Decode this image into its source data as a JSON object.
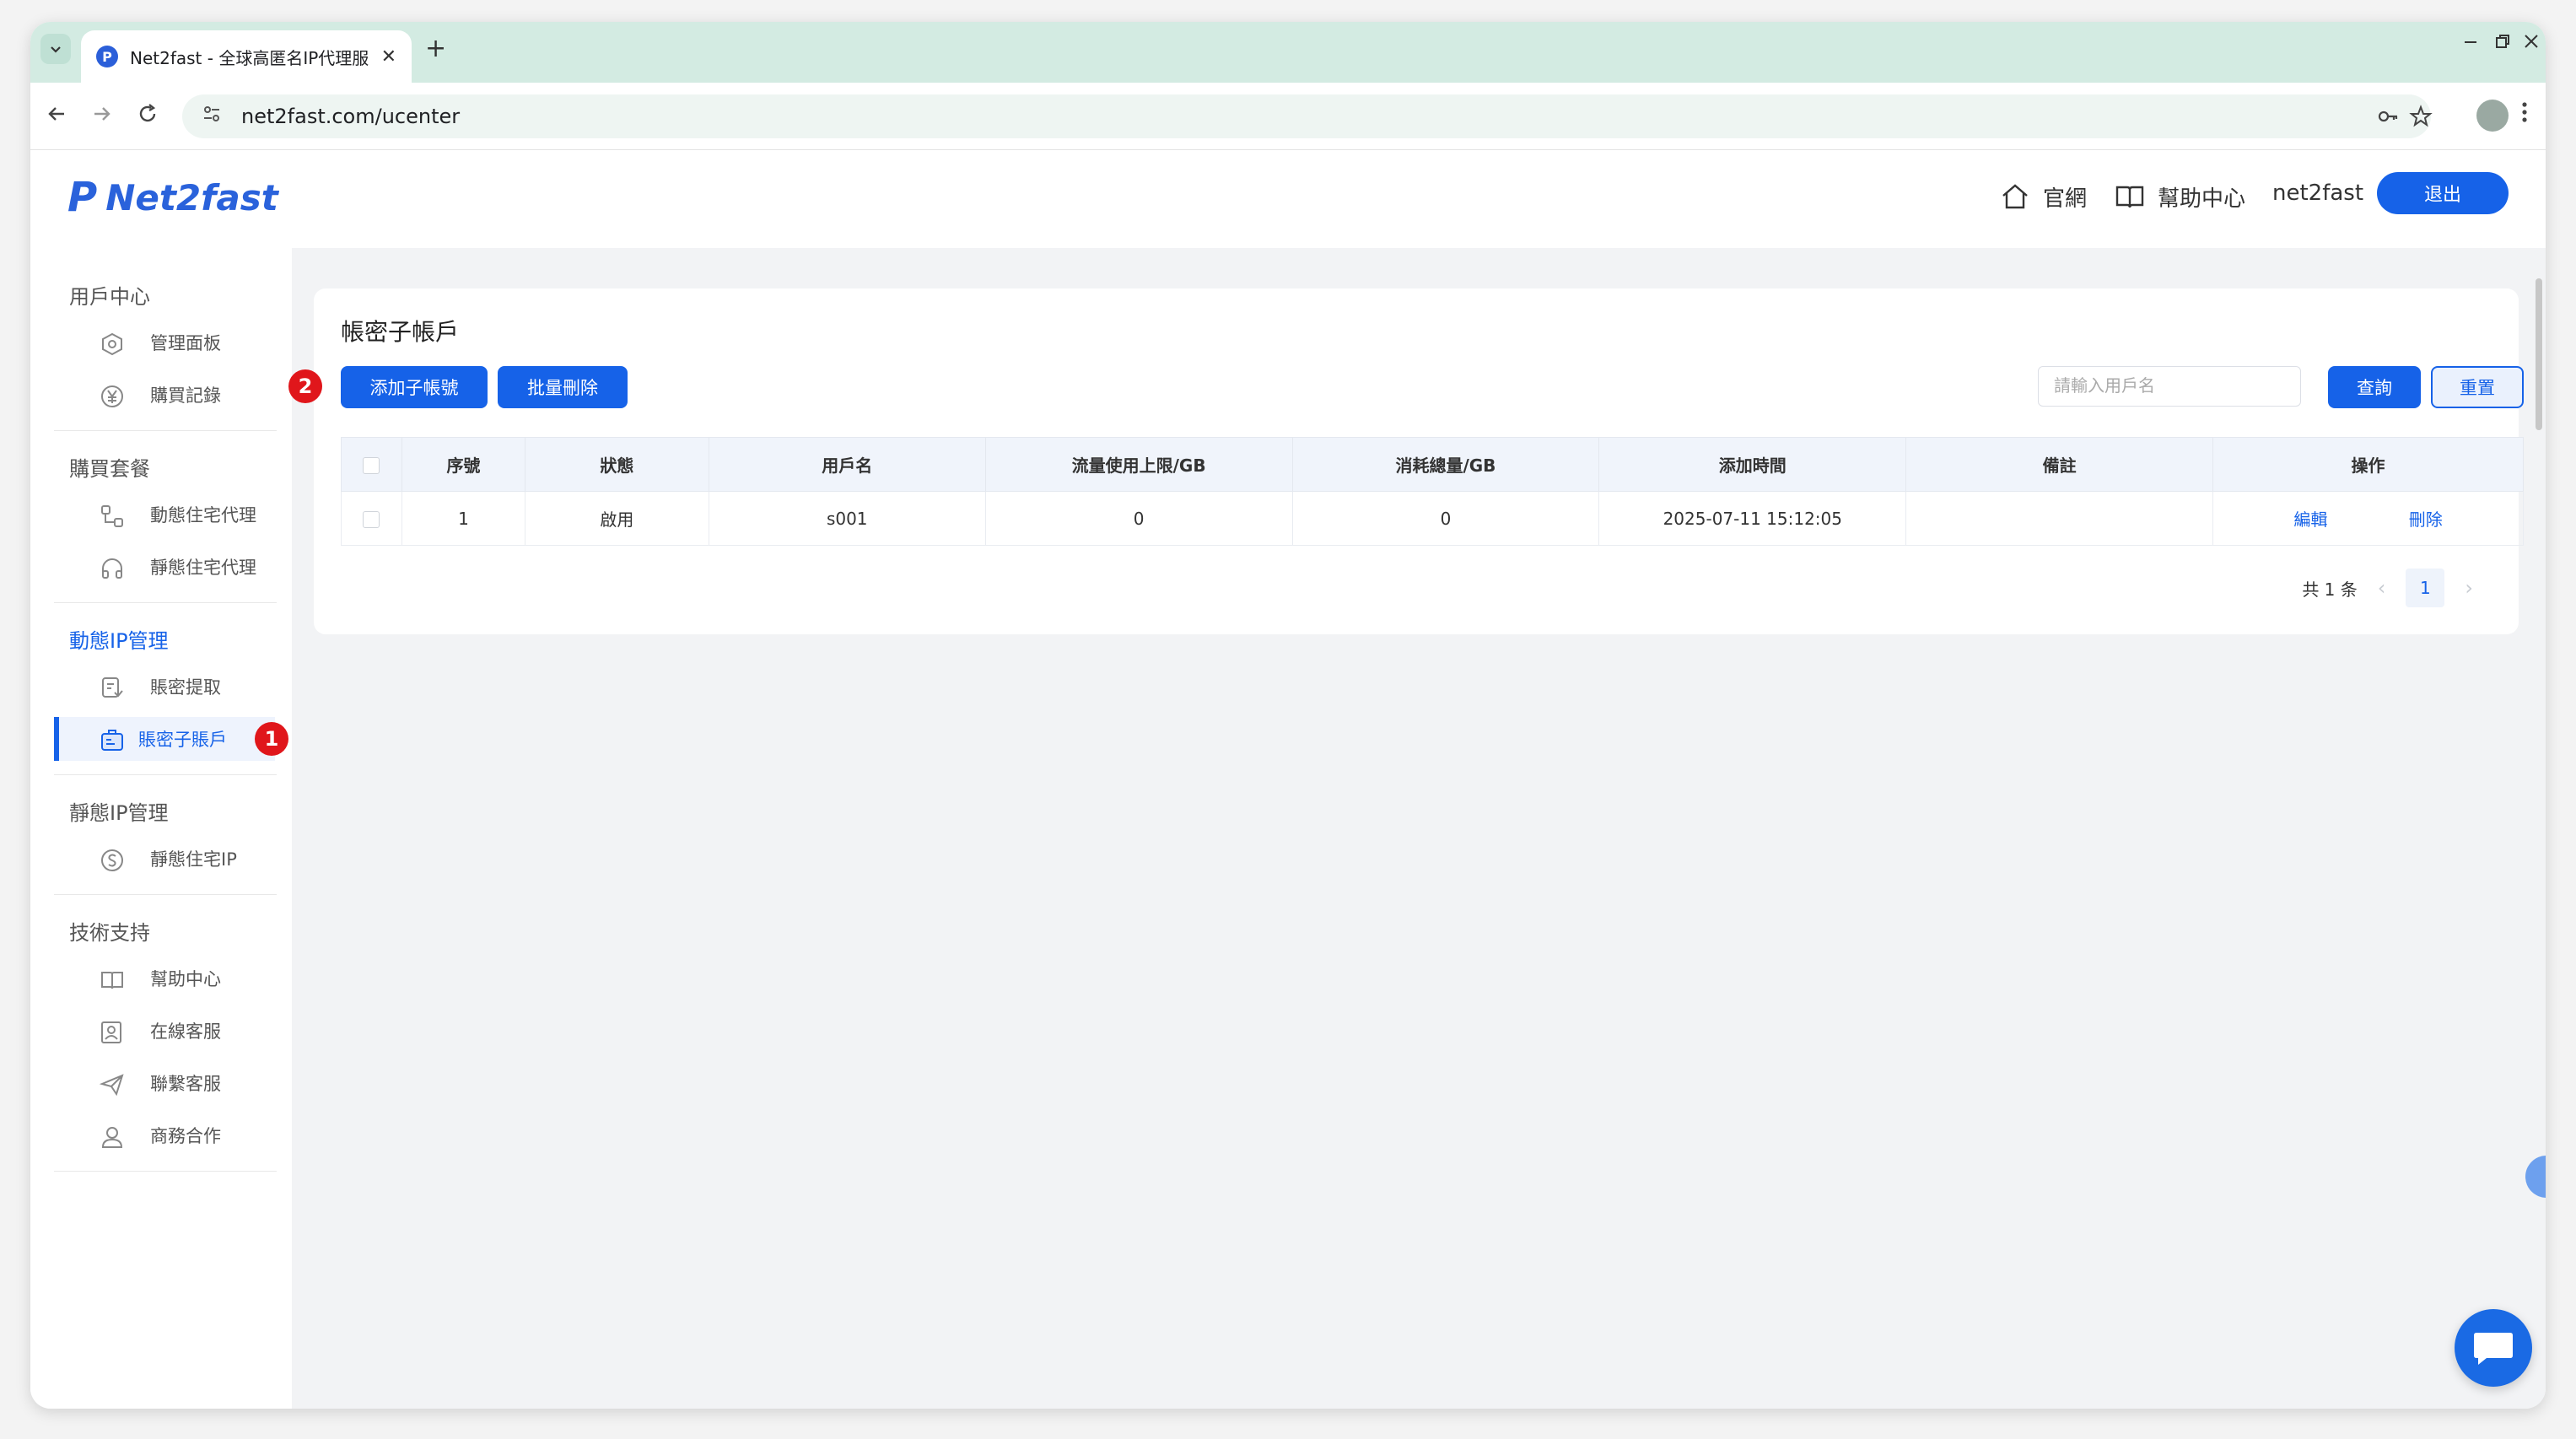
{
  "browser": {
    "tab_title": "Net2fast - 全球高匿名IP代理服",
    "tab_favicon": "P",
    "url": "net2fast.com/ucenter",
    "new_tab": "+",
    "close_tab": "✕"
  },
  "header": {
    "logo_mark": "P",
    "logo_text": "Net2fast",
    "home_label": "官網",
    "help_label": "幫助中心",
    "username": "net2fast",
    "logout_label": "退出"
  },
  "sidebar": {
    "groups": [
      {
        "title": "用戶中心",
        "items": [
          {
            "label": "管理面板",
            "icon": "dashboard-icon"
          },
          {
            "label": "購買記錄",
            "icon": "yuan-icon"
          }
        ]
      },
      {
        "title": "購買套餐",
        "items": [
          {
            "label": "動態住宅代理",
            "icon": "nodes-icon"
          },
          {
            "label": "靜態住宅代理",
            "icon": "headset-icon"
          }
        ]
      },
      {
        "title": "動態IP管理",
        "items": [
          {
            "label": "賬密提取",
            "icon": "extract-icon"
          },
          {
            "label": "賬密子賬戶",
            "icon": "badge-icon"
          }
        ]
      },
      {
        "title": "靜態IP管理",
        "items": [
          {
            "label": "靜態住宅IP",
            "icon": "dollar-icon"
          }
        ]
      },
      {
        "title": "技術支持",
        "items": [
          {
            "label": "幫助中心",
            "icon": "book-icon"
          },
          {
            "label": "在線客服",
            "icon": "contact-icon"
          },
          {
            "label": "聯繫客服",
            "icon": "send-icon"
          },
          {
            "label": "商務合作",
            "icon": "person-icon"
          }
        ]
      }
    ]
  },
  "annotations": {
    "step1": "1",
    "step2": "2"
  },
  "main": {
    "title": "帳密子帳戶",
    "add_button": "添加子帳號",
    "batch_delete_button": "批量刪除",
    "search_placeholder": "請輸入用戶名",
    "query_button": "查詢",
    "reset_button": "重置",
    "table": {
      "headers": [
        "序號",
        "狀態",
        "用戶名",
        "流量使用上限/GB",
        "消耗總量/GB",
        "添加時間",
        "備註",
        "操作"
      ],
      "rows": [
        {
          "index": "1",
          "status": "啟用",
          "username": "s001",
          "limit": "0",
          "used": "0",
          "time": "2025-07-11 15:12:05",
          "remark": "",
          "edit": "編輯",
          "delete": "刪除"
        }
      ]
    },
    "pager": {
      "total": "共 1 条",
      "page": "1",
      "prev": "‹",
      "next": "›"
    }
  },
  "colors": {
    "accent": "#1662e8",
    "badge": "#e0161b",
    "tabstrip": "#d3ebe2"
  }
}
